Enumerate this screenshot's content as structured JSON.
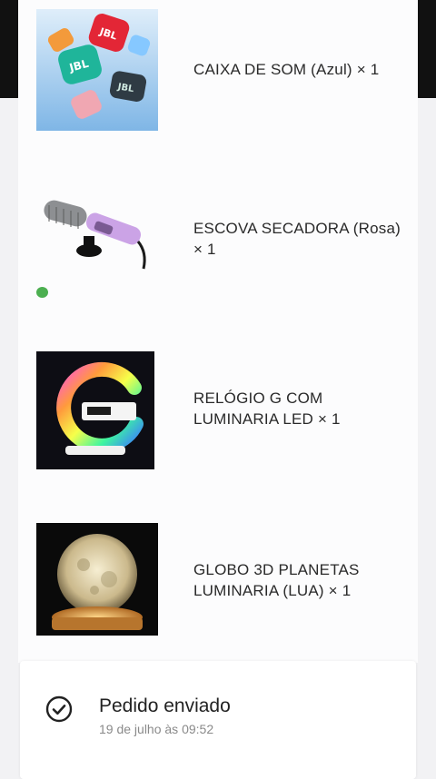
{
  "order": {
    "items": [
      {
        "label": "CAIXA DE SOM (Azul) × 1",
        "icon": "jbl-speakers-image"
      },
      {
        "label": "ESCOVA SECADORA (Rosa) × 1",
        "icon": "hair-dryer-brush-image"
      },
      {
        "label": "RELÓGIO G COM LUMINARIA LED × 1",
        "icon": "g-clock-led-lamp-image"
      },
      {
        "label": "GLOBO 3D PLANETAS LUMINARIA (LUA) × 1",
        "icon": "moon-globe-lamp-image"
      }
    ]
  },
  "status": {
    "title": "Pedido enviado",
    "date": "19 de julho às 09:52",
    "icon": "check-circle-icon"
  },
  "colors": {
    "badge": "#4caf50",
    "text": "#2a2a2a",
    "muted": "#8a8a8a"
  }
}
